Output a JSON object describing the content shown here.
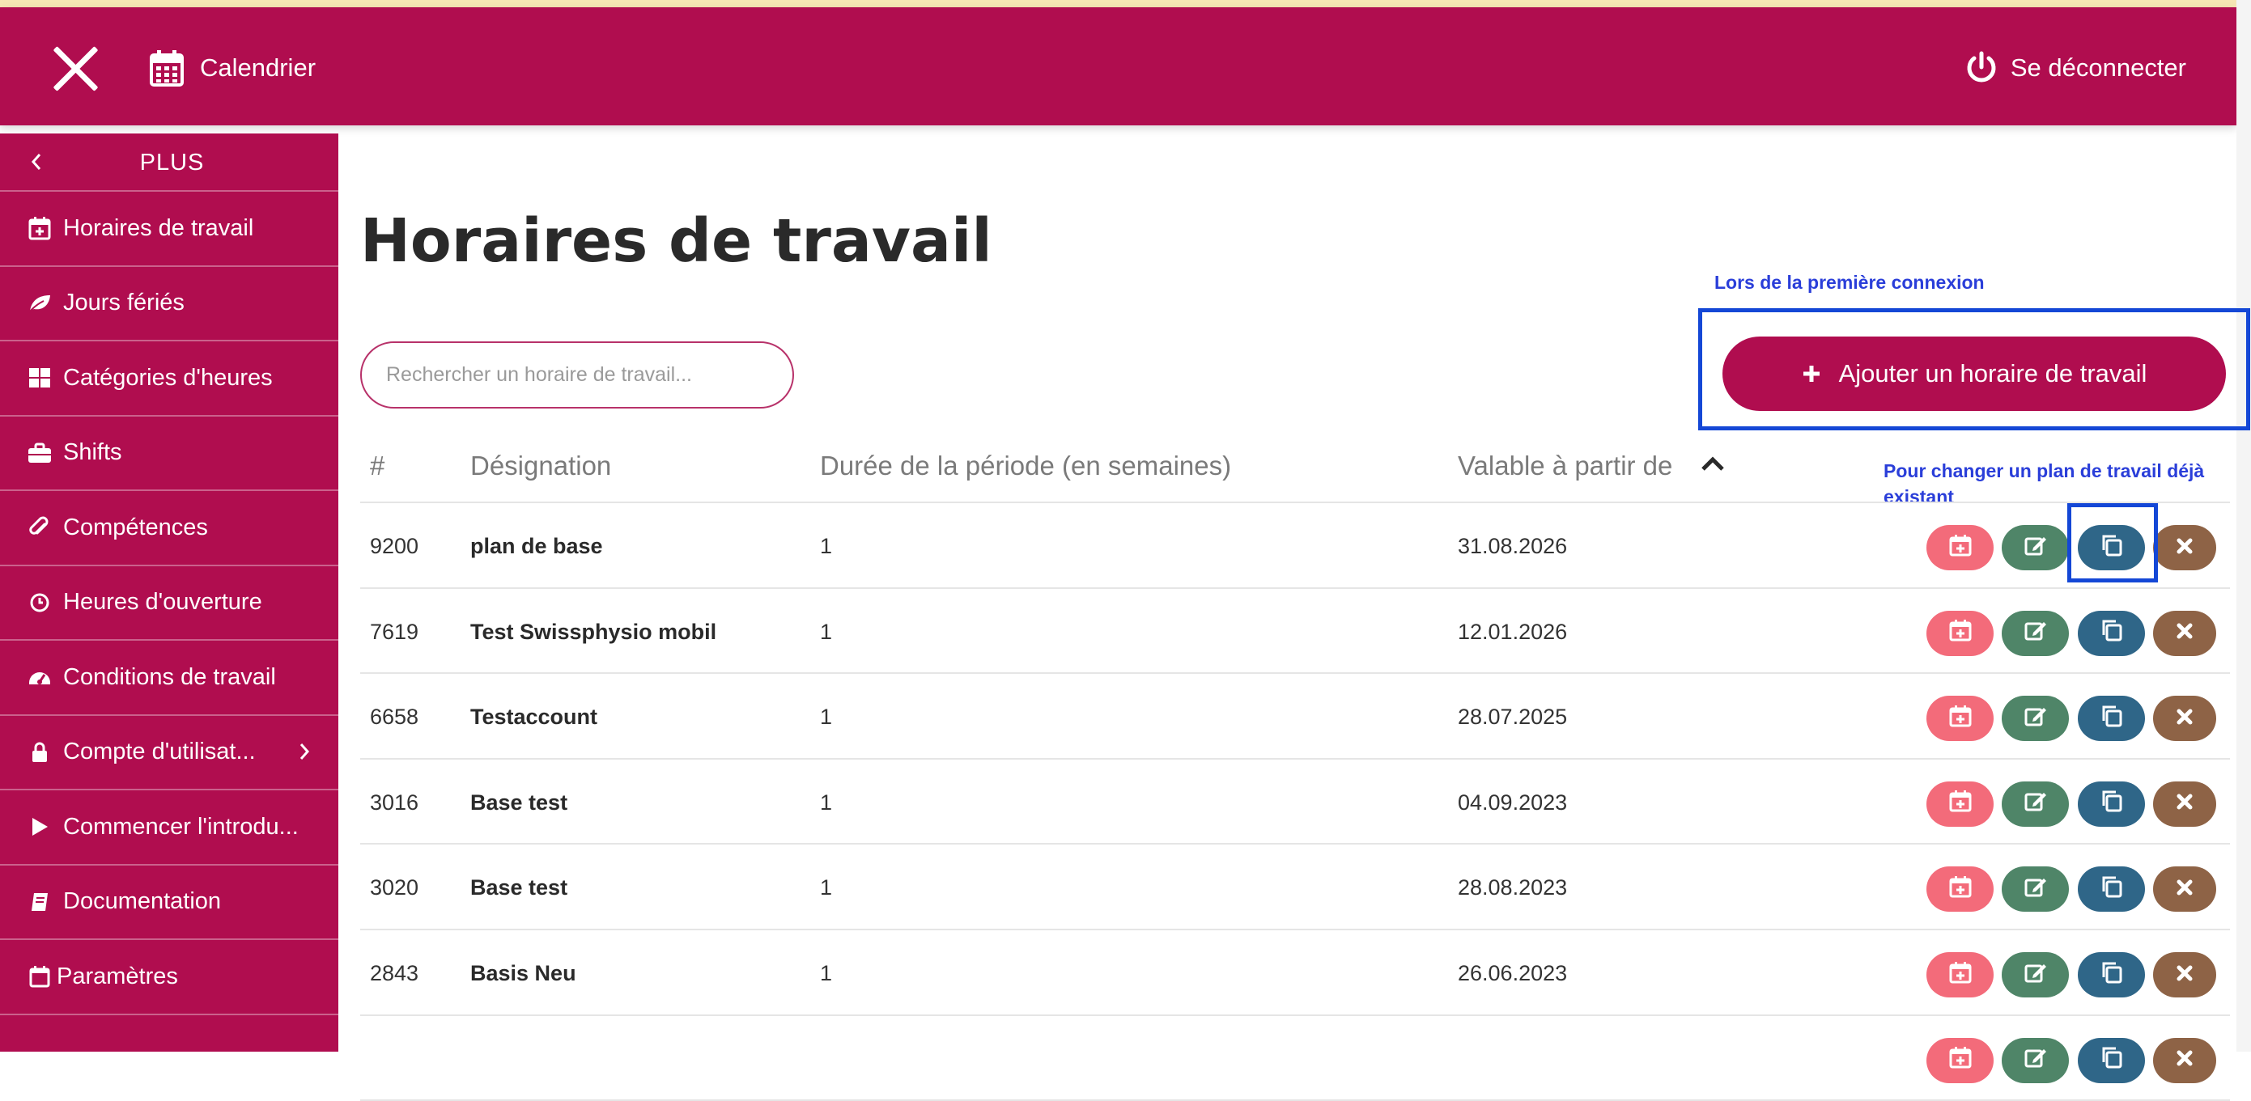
{
  "topbar": {
    "calendar_label": "Calendrier",
    "logout_label": "Se déconnecter"
  },
  "sidebar": {
    "header": "PLUS",
    "items": [
      {
        "label": "Horaires de travail",
        "icon": "calendar-plus-icon"
      },
      {
        "label": "Jours fériés",
        "icon": "leaf-icon"
      },
      {
        "label": "Catégories d'heures",
        "icon": "grid-icon"
      },
      {
        "label": "Shifts",
        "icon": "briefcase-icon"
      },
      {
        "label": "Compétences",
        "icon": "paperclip-icon"
      },
      {
        "label": "Heures d'ouverture",
        "icon": "clock-icon"
      },
      {
        "label": "Conditions de travail",
        "icon": "gauge-icon"
      },
      {
        "label": "Compte d'utilisat...",
        "icon": "lock-icon"
      },
      {
        "label": "Commencer l'introdu...",
        "icon": "play-icon"
      },
      {
        "label": "Documentation",
        "icon": "book-icon"
      },
      {
        "label": "Paramètres",
        "icon": "calendar-icon"
      }
    ]
  },
  "main": {
    "title": "Horaires de travail",
    "search_placeholder": "Rechercher un horaire de travail...",
    "add_button_label": "Ajouter un horaire de travail",
    "annotation_first_login": "Lors de la première connexion",
    "annotation_change_plan": "Pour changer un plan de travail déjà existant"
  },
  "table": {
    "columns": [
      "#",
      "Désignation",
      "Durée de la période (en semaines)",
      "Valable à partir de"
    ],
    "rows": [
      {
        "id": "9200",
        "name": "plan de base",
        "duration": "1",
        "valid_from": "31.08.2026"
      },
      {
        "id": "7619",
        "name": "Test Swissphysio mobil",
        "duration": "1",
        "valid_from": "12.01.2026"
      },
      {
        "id": "6658",
        "name": "Testaccount",
        "duration": "1",
        "valid_from": "28.07.2025"
      },
      {
        "id": "3016",
        "name": "Base test",
        "duration": "1",
        "valid_from": "04.09.2023"
      },
      {
        "id": "3020",
        "name": "Base test",
        "duration": "1",
        "valid_from": "28.08.2023"
      },
      {
        "id": "2843",
        "name": "Basis Neu",
        "duration": "1",
        "valid_from": "26.06.2023"
      }
    ]
  },
  "colors": {
    "brand": "#b00d4f",
    "action_calendar": "#f36b7a",
    "action_edit": "#4f8568",
    "action_copy": "#2f6688",
    "action_delete": "#8e6346",
    "annotation": "#1447d6"
  }
}
